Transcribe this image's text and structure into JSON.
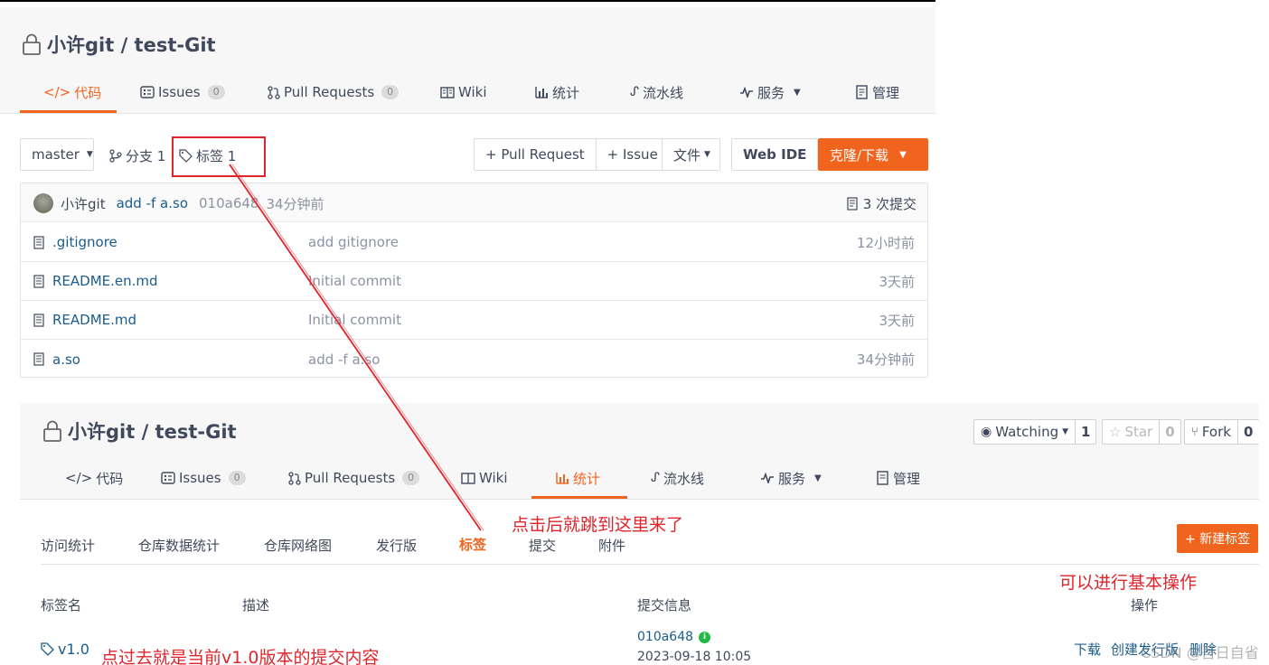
{
  "repo1": {
    "title": "小许git / test-Git",
    "tabs": [
      {
        "label": "代码",
        "icon": "code-icon"
      },
      {
        "label": "Issues",
        "badge": "0",
        "icon": "issue-icon"
      },
      {
        "label": "Pull Requests",
        "badge": "0",
        "icon": "pull-request-icon"
      },
      {
        "label": "Wiki",
        "icon": "book-icon"
      },
      {
        "label": "统计",
        "icon": "bar-chart-icon"
      },
      {
        "label": "流水线",
        "icon": "pipeline-icon"
      },
      {
        "label": "服务",
        "icon": "pulse-icon"
      },
      {
        "label": "管理",
        "icon": "settings-doc-icon"
      }
    ],
    "branch_select": "master",
    "branches_label": "分支 1",
    "tags_label": "标签 1",
    "btn_pull_request": "+ Pull Request",
    "btn_issue": "+ Issue",
    "btn_file": "文件",
    "btn_webide": "Web IDE",
    "btn_clone": "克隆/下载",
    "commit": {
      "author": "小许git",
      "message": "add -f a.so",
      "hash": "010a648",
      "time": "34分钟前",
      "count": "3 次提交"
    },
    "files": [
      {
        "name": ".gitignore",
        "message": "add gitignore",
        "time": "12小时前"
      },
      {
        "name": "README.en.md",
        "message": "Initial commit",
        "time": "3天前"
      },
      {
        "name": "README.md",
        "message": "Initial commit",
        "time": "3天前"
      },
      {
        "name": "a.so",
        "message": "add -f a.so",
        "time": "34分钟前"
      }
    ]
  },
  "repo2": {
    "title": "小许git / test-Git",
    "watching_label": "Watching",
    "watching_count": "1",
    "star_label": "Star",
    "star_count": "0",
    "fork_label": "Fork",
    "fork_count": "0",
    "tabs": [
      {
        "label": "代码"
      },
      {
        "label": "Issues",
        "badge": "0"
      },
      {
        "label": "Pull Requests",
        "badge": "0"
      },
      {
        "label": "Wiki"
      },
      {
        "label": "统计"
      },
      {
        "label": "流水线"
      },
      {
        "label": "服务"
      },
      {
        "label": "管理"
      }
    ],
    "subnav": [
      "访问统计",
      "仓库数据统计",
      "仓库网络图",
      "发行版",
      "标签",
      "提交",
      "附件"
    ],
    "new_tag_btn": "+ 新建标签",
    "table_headers": {
      "name": "标签名",
      "desc": "描述",
      "commit": "提交信息",
      "ops": "操作"
    },
    "tag_row": {
      "name": "v1.0",
      "hash": "010a648",
      "date": "2023-09-18 10:05",
      "op_download": "下载",
      "op_create_release": "创建发行版",
      "op_delete": "删除"
    }
  },
  "annotations": {
    "jump_note": "点击后就跳到这里来了",
    "ops_note": "可以进行基本操作",
    "tag_note": "点过去就是当前v1.0版本的提交内容",
    "watermark": "CSDN @吾日自省"
  },
  "colors": {
    "accent": "#f1641e",
    "annotation_red": "#e0242c",
    "link_blue": "#1a5c8c",
    "success_green": "#21ba45"
  }
}
